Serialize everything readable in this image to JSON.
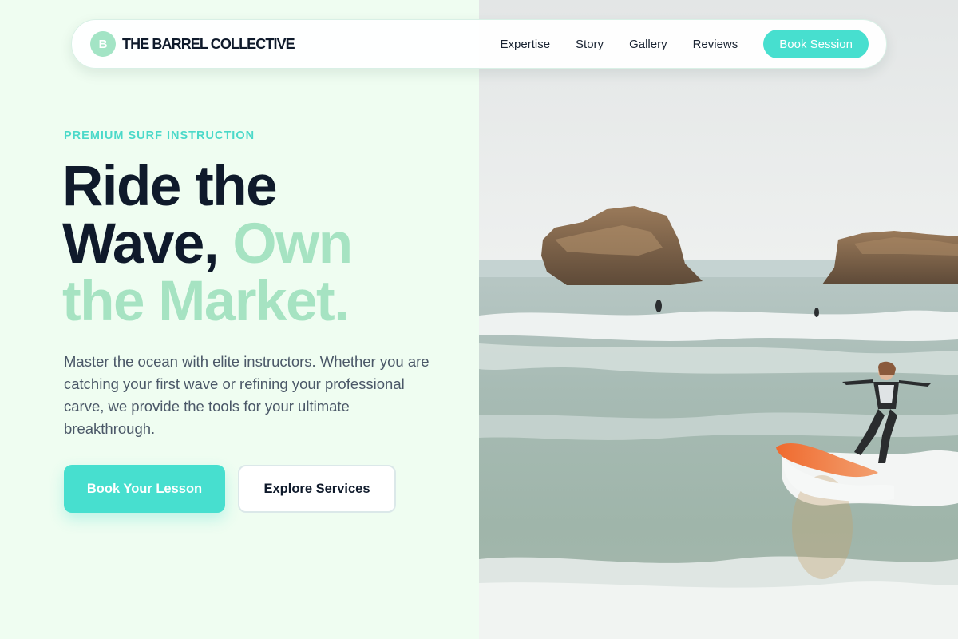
{
  "nav": {
    "brand_initial": "B",
    "brand_name": "THE BARREL COLLECTIVE",
    "links": [
      "Expertise",
      "Story",
      "Gallery",
      "Reviews"
    ],
    "cta_label": "Book Session"
  },
  "hero": {
    "eyebrow": "PREMIUM SURF INSTRUCTION",
    "headline_line1": "Ride the",
    "headline_line2_dark": "Wave,",
    "headline_line2_accent": "Own",
    "headline_line3": "the Market.",
    "lead": "Master the ocean with elite instructors. Whether you are catching your first wave or refining your professional carve, we provide the tools for your ultimate breakthrough.",
    "primary_cta": "Book Your Lesson",
    "secondary_cta": "Explore Services"
  },
  "image": {
    "subject": "surfer-photo"
  },
  "colors": {
    "accent": "#47dfcf",
    "accent_soft": "#a6e3c2",
    "background": "#effdf1",
    "text_dark": "#0f1a2b",
    "text_body": "#4b5868"
  }
}
